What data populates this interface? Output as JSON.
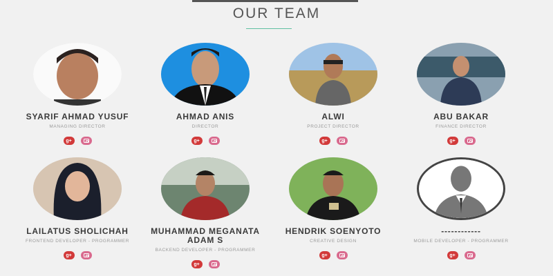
{
  "section": {
    "title": "OUR TEAM"
  },
  "colors": {
    "accent_line": "#5fbfa0",
    "gplus": "#d23a3a",
    "instagram": "#d96a8e"
  },
  "team": [
    {
      "name": "SYARIF AHMAD YUSUF",
      "role": "MANAGING DIRECTOR"
    },
    {
      "name": "AHMAD ANIS",
      "role": "DIRECTOR"
    },
    {
      "name": "ALWI",
      "role": "PROJECT DIRECTOR"
    },
    {
      "name": "ABU BAKAR",
      "role": "FINANCE DIRECTOR"
    },
    {
      "name": "LAILATUS SHOLICHAH",
      "role": "FRONTEND DEVELOPER - PROGRAMMER"
    },
    {
      "name": "MUHAMMAD MEGANATA ADAM S",
      "role": "BACKEND DEVELOPER - PROGRAMMER"
    },
    {
      "name": "HENDRIK SOENYOTO",
      "role": "CREATIVE DESIGN"
    },
    {
      "name": "------------",
      "role": "MOBILE DEVELOPER - PROGRAMMER"
    }
  ],
  "social": {
    "gplus_label": "g+"
  }
}
